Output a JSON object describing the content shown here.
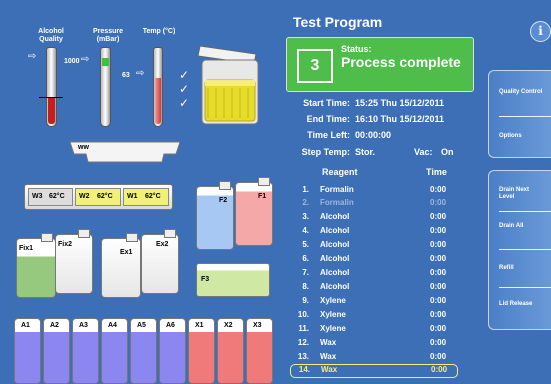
{
  "colors": {
    "background": "#3d6fb7",
    "status_green": "#4ebd4a",
    "highlight": "#f0f07a",
    "disabled": "#9db6d8",
    "alcohol_red": "#c41e1e",
    "pressure_green": "#3cc23c"
  },
  "gauges": [
    {
      "label": "Alcohol Quality"
    },
    {
      "label": "Pressure (mBar)",
      "value": "1000"
    },
    {
      "label": "Temp (°C)",
      "value": "63"
    }
  ],
  "waxbath": {
    "label": "ww"
  },
  "wax_slots": [
    {
      "name": "W3",
      "temp": "62°C"
    },
    {
      "name": "W2",
      "temp": "62°C"
    },
    {
      "name": "W1",
      "temp": "62°C"
    }
  ],
  "containers": {
    "fix1": "Fix1",
    "fix2": "Fix2",
    "ex1": "Ex1",
    "ex2": "Ex2",
    "f1": "F1",
    "f2": "F2",
    "f3": "F3"
  },
  "bottles": [
    "A1",
    "A2",
    "A3",
    "A4",
    "A5",
    "A6",
    "X1",
    "X2",
    "X3"
  ],
  "program": {
    "title": "Test Program",
    "step": "3",
    "status_label": "Status:",
    "status_value": "Process complete",
    "start_label": "Start Time:",
    "start_value": "15:25  Thu 15/12/2011",
    "end_label": "End Time:",
    "end_value": "16:10  Thu 15/12/2011",
    "left_label": "Time Left:",
    "left_value": "00:00:00",
    "steptemp_label": "Step Temp:",
    "steptemp_value": "Stor.",
    "vac_label": "Vac:",
    "vac_value": "On",
    "col_reagent": "Reagent",
    "col_time": "Time"
  },
  "steps": [
    {
      "n": "1.",
      "reagent": "Formalin",
      "time": "0:00"
    },
    {
      "n": "2.",
      "reagent": "Formalin",
      "time": "0:00"
    },
    {
      "n": "3.",
      "reagent": "Alcohol",
      "time": "0:00"
    },
    {
      "n": "4.",
      "reagent": "Alcohol",
      "time": "0:00"
    },
    {
      "n": "5.",
      "reagent": "Alcohol",
      "time": "0:00"
    },
    {
      "n": "6.",
      "reagent": "Alcohol",
      "time": "0:00"
    },
    {
      "n": "7.",
      "reagent": "Alcohol",
      "time": "0:00"
    },
    {
      "n": "8.",
      "reagent": "Alcohol",
      "time": "0:00"
    },
    {
      "n": "9.",
      "reagent": "Xylene",
      "time": "0:00"
    },
    {
      "n": "10.",
      "reagent": "Xylene",
      "time": "0:00"
    },
    {
      "n": "11.",
      "reagent": "Xylene",
      "time": "0:00"
    },
    {
      "n": "12.",
      "reagent": "Wax",
      "time": "0:00"
    },
    {
      "n": "13.",
      "reagent": "Wax",
      "time": "0:00"
    },
    {
      "n": "14.",
      "reagent": "Wax",
      "time": "0:00"
    }
  ],
  "sidebar": {
    "info": "i",
    "group1": [
      "Quality Control",
      "Options"
    ],
    "group2": [
      "Drain Next Level",
      "Drain All",
      "Refill",
      "Lid Release"
    ]
  }
}
